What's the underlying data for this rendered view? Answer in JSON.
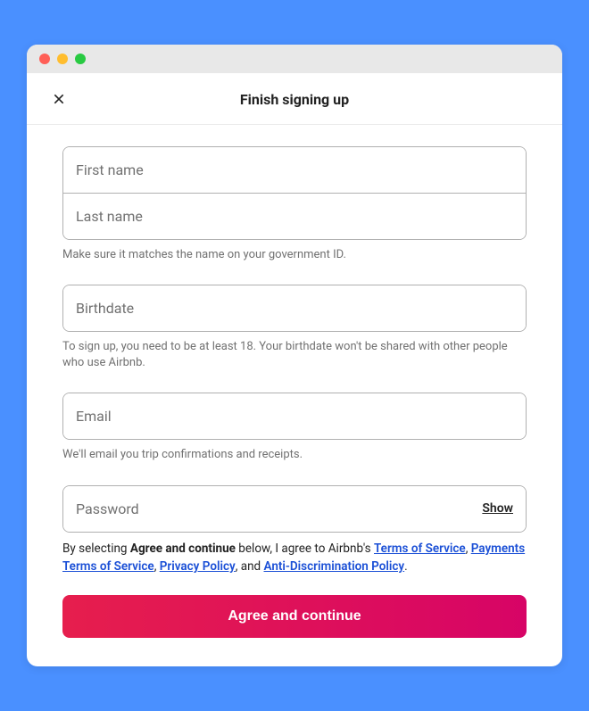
{
  "header": {
    "title": "Finish signing up"
  },
  "fields": {
    "first_name": "First name",
    "last_name": "Last name",
    "name_hint": "Make sure it matches the name on your government ID.",
    "birthdate": "Birthdate",
    "birthdate_hint": "To sign up, you need to be at least 18. Your birthdate won't be shared with other people who use Airbnb.",
    "email": "Email",
    "email_hint": "We'll email you trip confirmations and receipts.",
    "password": "Password",
    "show_label": "Show"
  },
  "legal": {
    "pre": "By selecting ",
    "bold": "Agree and continue",
    "mid": " below, I agree to Airbnb's ",
    "tos": "Terms of Service",
    "c1": ", ",
    "ptos": "Payments Terms of Service",
    "c2": ", ",
    "pp": "Privacy Policy",
    "c3": ", and ",
    "adp": "Anti-Discrimination Policy",
    "end": "."
  },
  "cta": {
    "label": "Agree and continue"
  }
}
